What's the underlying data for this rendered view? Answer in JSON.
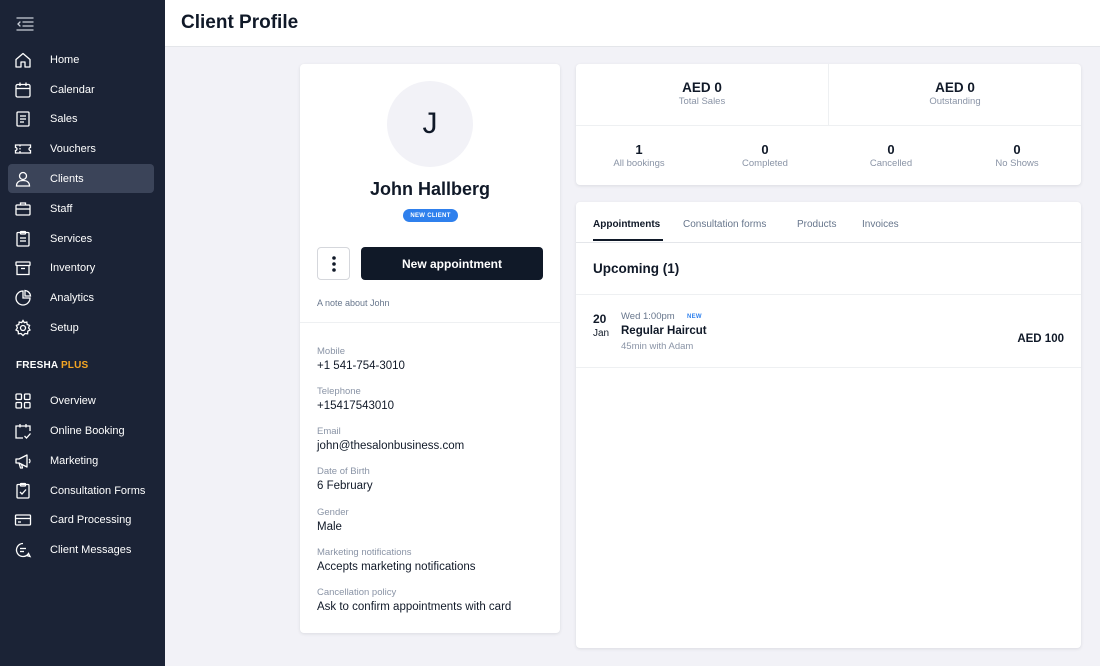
{
  "header": {
    "title": "Client Profile"
  },
  "sidebar": {
    "items": [
      {
        "label": "Home",
        "icon": "home-icon"
      },
      {
        "label": "Calendar",
        "icon": "calendar-icon"
      },
      {
        "label": "Sales",
        "icon": "sales-icon"
      },
      {
        "label": "Vouchers",
        "icon": "voucher-icon"
      },
      {
        "label": "Clients",
        "icon": "user-icon",
        "active": true
      },
      {
        "label": "Staff",
        "icon": "briefcase-icon"
      },
      {
        "label": "Services",
        "icon": "services-icon"
      },
      {
        "label": "Inventory",
        "icon": "inventory-icon"
      },
      {
        "label": "Analytics",
        "icon": "analytics-icon"
      },
      {
        "label": "Setup",
        "icon": "gear-icon"
      }
    ],
    "brand": {
      "name": "FRESHA",
      "plus": "PLUS"
    },
    "plus_items": [
      {
        "label": "Overview",
        "icon": "grid-icon"
      },
      {
        "label": "Online Booking",
        "icon": "calendar-check-icon"
      },
      {
        "label": "Marketing",
        "icon": "megaphone-icon"
      },
      {
        "label": "Consultation Forms",
        "icon": "clipboard-check-icon"
      },
      {
        "label": "Card Processing",
        "icon": "card-icon"
      },
      {
        "label": "Client Messages",
        "icon": "chat-icon"
      }
    ]
  },
  "profile": {
    "initial": "J",
    "name": "John Hallberg",
    "badge": "NEW CLIENT",
    "new_appointment_label": "New appointment",
    "note_placeholder": "A note about John",
    "fields": [
      {
        "label": "Mobile",
        "value": "+1 541-754-3010"
      },
      {
        "label": "Telephone",
        "value": "+15417543010"
      },
      {
        "label": "Email",
        "value": "john@thesalonbusiness.com"
      },
      {
        "label": "Date of Birth",
        "value": "6 February"
      },
      {
        "label": "Gender",
        "value": "Male"
      },
      {
        "label": "Marketing notifications",
        "value": "Accepts marketing notifications"
      },
      {
        "label": "Cancellation policy",
        "value": "Ask to confirm appointments with card"
      }
    ]
  },
  "stats": {
    "total_sales": {
      "amount": "AED 0",
      "label": "Total Sales"
    },
    "outstanding": {
      "amount": "AED 0",
      "label": "Outstanding"
    },
    "counts": [
      {
        "value": "1",
        "label": "All bookings"
      },
      {
        "value": "0",
        "label": "Completed"
      },
      {
        "value": "0",
        "label": "Cancelled"
      },
      {
        "value": "0",
        "label": "No Shows"
      }
    ]
  },
  "appointments": {
    "tabs": [
      "Appointments",
      "Consultation forms",
      "Products",
      "Invoices"
    ],
    "upcoming_title": "Upcoming (1)",
    "items": [
      {
        "day": "20",
        "month": "Jan",
        "time": "Wed 1:00pm",
        "status": "NEW",
        "service": "Regular Haircut",
        "detail": "45min with Adam",
        "price": "AED 100"
      }
    ]
  },
  "colors": {
    "sidebar_bg": "#1b2336",
    "sidebar_active": "#3b4459",
    "accent_blue": "#2f80ed",
    "brand_plus": "#f5a623",
    "primary_button": "#101928"
  }
}
